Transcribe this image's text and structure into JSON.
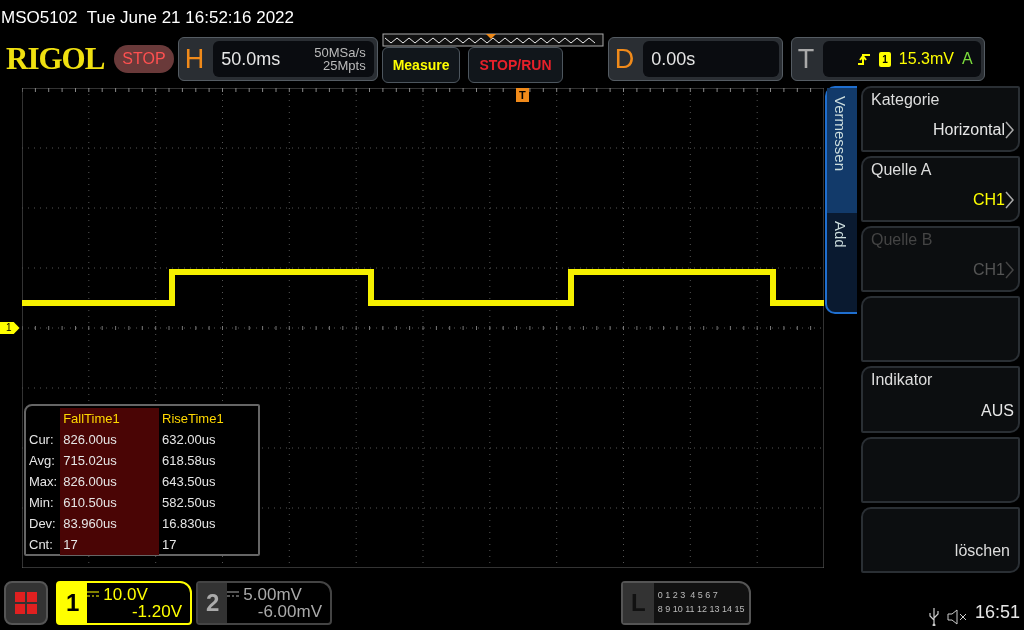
{
  "title_bar": {
    "model": "MSO5102",
    "datetime": "Tue June 21 16:52:16 2022"
  },
  "header": {
    "logo": "RIGOL",
    "run_state": "STOP",
    "horizontal": {
      "label": "H",
      "timebase": "50.0ms",
      "sample_rate": "50MSa/s",
      "memory_depth": "25Mpts"
    },
    "buttons": [
      {
        "label": "Measure",
        "color": "#ffff00"
      },
      {
        "label": "STOP/RUN",
        "color": "#e8202a"
      }
    ],
    "delay": {
      "label": "D",
      "value": "0.00s"
    },
    "trigger": {
      "label": "T",
      "source": "1",
      "level": "15.3mV",
      "mode": "A"
    }
  },
  "screen": {
    "trigger_marker": "T",
    "channel_marker": "1"
  },
  "measurements": {
    "columns": [
      {
        "label": "FallTime1",
        "selected": true
      },
      {
        "label": "RiseTime1",
        "selected": false
      }
    ],
    "rows": [
      {
        "label": "Cur:",
        "values": [
          "826.00us",
          "632.00us"
        ]
      },
      {
        "label": "Avg:",
        "values": [
          "715.02us",
          "618.58us"
        ]
      },
      {
        "label": "Max:",
        "values": [
          "826.00us",
          "643.50us"
        ]
      },
      {
        "label": "Min:",
        "values": [
          "610.50us",
          "582.50us"
        ]
      },
      {
        "label": "Dev:",
        "values": [
          "83.960us",
          "16.830us"
        ]
      },
      {
        "label": "Cnt:",
        "values": [
          "17",
          "17"
        ]
      }
    ]
  },
  "side_menu": {
    "tabs": [
      {
        "label": "Vermessen",
        "selected": true
      },
      {
        "label": "Add",
        "selected": false
      }
    ],
    "items": [
      {
        "kind": "submenu",
        "label": "Kategorie",
        "value": "Horizontal",
        "color": "#e6e6e6",
        "disabled": false
      },
      {
        "kind": "submenu",
        "label": "Quelle A",
        "value": "CH1",
        "color": "#ffff00",
        "disabled": false
      },
      {
        "kind": "submenu",
        "label": "Quelle B",
        "value": "CH1",
        "disabled": true
      },
      {
        "kind": "empty"
      },
      {
        "kind": "value",
        "label": "Indikator",
        "value": "AUS",
        "color": "#e6e6e6",
        "disabled": false
      },
      {
        "kind": "empty"
      },
      {
        "kind": "action",
        "label": "löschen",
        "disabled": false
      }
    ]
  },
  "channels": [
    {
      "number": "1",
      "scale": "10.0V",
      "offset": "-1.20V",
      "active": true
    },
    {
      "number": "2",
      "scale": "5.00mV",
      "offset": "-6.00mV",
      "active": false
    }
  ],
  "logic": {
    "label": "L",
    "lines": [
      "0 1 2 3  4 5 6 7",
      "8 9 10 11 12 13 14 15"
    ]
  },
  "status": {
    "muted": true,
    "time": "16:51"
  }
}
